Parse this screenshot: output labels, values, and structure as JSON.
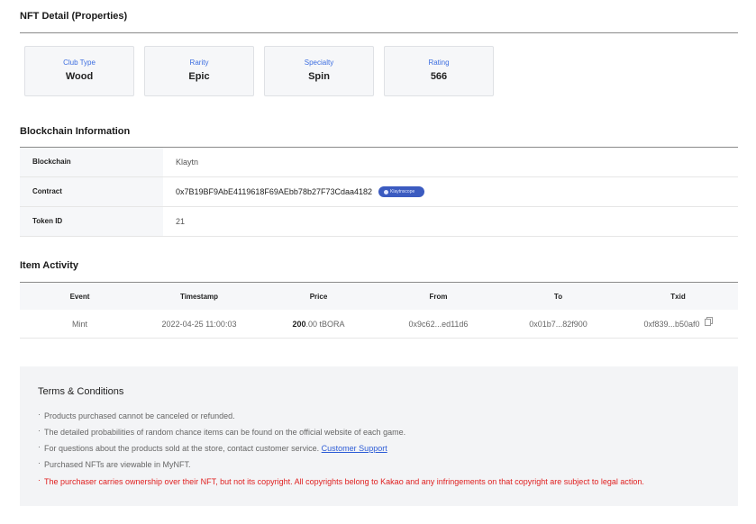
{
  "nft_detail": {
    "title": "NFT Detail (Properties)",
    "properties": [
      {
        "label": "Club Type",
        "value": "Wood"
      },
      {
        "label": "Rarity",
        "value": "Epic"
      },
      {
        "label": "Specialty",
        "value": "Spin"
      },
      {
        "label": "Rating",
        "value": "566"
      }
    ]
  },
  "blockchain": {
    "title": "Blockchain Information",
    "rows": [
      {
        "label": "Blockchain",
        "value": "Klaytn"
      },
      {
        "label": "Contract",
        "value": "0x7B19BF9AbE4119618F69AEbb78b27F73Cdaa4182",
        "badge": "Klaytnscope"
      },
      {
        "label": "Token ID",
        "value": "21"
      }
    ]
  },
  "activity": {
    "title": "Item Activity",
    "headers": [
      "Event",
      "Timestamp",
      "Price",
      "From",
      "To",
      "Txid"
    ],
    "rows": [
      {
        "event": "Mint",
        "timestamp": "2022-04-25 11:00:03",
        "price_amount": "200",
        "price_rest": ".00 tBORA",
        "from": "0x9c62...ed11d6",
        "to": "0x01b7...82f900",
        "txid": "0xf839...b50af0"
      }
    ]
  },
  "terms": {
    "title": "Terms & Conditions",
    "items": [
      "Products purchased cannot be canceled or refunded.",
      "The detailed probabilities of random chance items can be found on the official website of each game.",
      "For questions about the products sold at the store, contact customer service.",
      "Purchased NFTs are viewable in MyNFT.",
      "The purchaser carries ownership over their NFT, but not its copyright. All copyrights belong to Kakao and any infringements on that copyright are subject to legal action."
    ],
    "link_label": "Customer Support",
    "bullet": "·"
  },
  "colors": {
    "accent": "#3d6ee0",
    "warning": "#e02020",
    "badge": "#3b5bc0"
  }
}
